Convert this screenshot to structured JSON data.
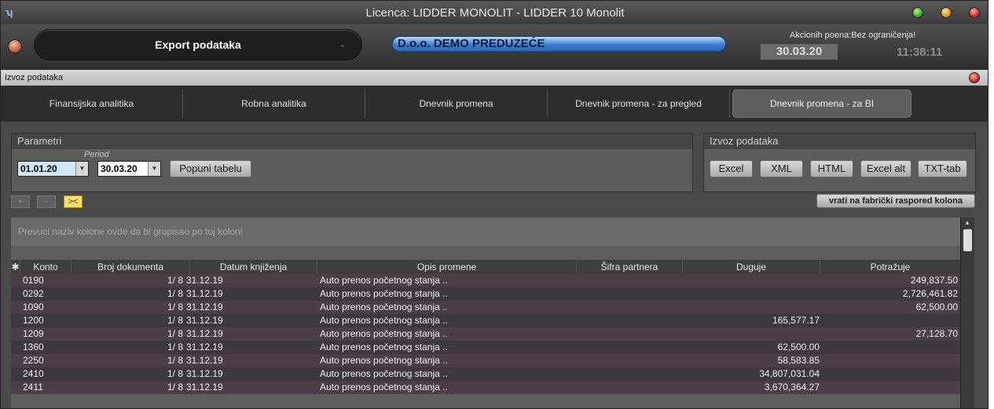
{
  "window": {
    "title": "Licenca: LIDDER MONOLIT - LIDDER 10 Monolit",
    "icon": "app-logo-icon"
  },
  "header": {
    "module": "Export podataka",
    "module_dash": "-",
    "company": "D.o.o. DEMO PREDUZEĆE",
    "promo": "Akcionih poena:Bez ograničenja!",
    "date": "30.03.20",
    "time": "11:38:11"
  },
  "subwindow": {
    "title": "Izvoz podataka"
  },
  "tabs": [
    {
      "label": "Finansijska analitika"
    },
    {
      "label": "Robna analitika"
    },
    {
      "label": "Dnevnik promena"
    },
    {
      "label": "Dnevnik promena - za pregled"
    },
    {
      "label": "Dnevnik promena - za BI",
      "active": true
    }
  ],
  "params": {
    "title": "Parametri",
    "period_label": "Period",
    "from": "01.01.20",
    "to": "30.03.20",
    "fill_button": "Popuni tabelu"
  },
  "export": {
    "title": "Izvoz podataka",
    "buttons": [
      "Excel",
      "XML",
      "HTML",
      "Excel alt",
      "TXT-tab"
    ]
  },
  "toolbar": {
    "plus": "+",
    "minus": "-",
    "collapse": "><",
    "reset_columns": "vrati na fabrički raspored kolona"
  },
  "grid": {
    "group_hint": "Prevuci naziv kolone ovde da bi grupisao po toj koloni",
    "columns": [
      "Konto",
      "Broj dokumenta",
      "Datum knjiženja",
      "Opis promene",
      "Šifra partnera",
      "Duguje",
      "Potražuje"
    ],
    "rows": [
      {
        "konto": "0190",
        "broj": "1/ 8",
        "datum": "31.12.19",
        "opis": "Auto prenos početnog stanja ..",
        "sifra": "",
        "duguje": "",
        "potrazuje": "249,837.50"
      },
      {
        "konto": "0292",
        "broj": "1/ 8",
        "datum": "31.12.19",
        "opis": "Auto prenos početnog stanja ..",
        "sifra": "",
        "duguje": "",
        "potrazuje": "2,726,461.82"
      },
      {
        "konto": "1090",
        "broj": "1/ 8",
        "datum": "31.12.19",
        "opis": "Auto prenos početnog stanja ..",
        "sifra": "",
        "duguje": "",
        "potrazuje": "62,500.00"
      },
      {
        "konto": "1200",
        "broj": "1/ 8",
        "datum": "31.12.19",
        "opis": "Auto prenos početnog stanja ..",
        "sifra": "",
        "duguje": "165,577.17",
        "potrazuje": ""
      },
      {
        "konto": "1209",
        "broj": "1/ 8",
        "datum": "31.12.19",
        "opis": "Auto prenos početnog stanja ..",
        "sifra": "",
        "duguje": "",
        "potrazuje": "27,128.70"
      },
      {
        "konto": "1360",
        "broj": "1/ 8",
        "datum": "31.12.19",
        "opis": "Auto prenos početnog stanja ..",
        "sifra": "",
        "duguje": "62,500.00",
        "potrazuje": ""
      },
      {
        "konto": "2250",
        "broj": "1/ 8",
        "datum": "31.12.19",
        "opis": "Auto prenos početnog stanja ..",
        "sifra": "",
        "duguje": "58,583.85",
        "potrazuje": ""
      },
      {
        "konto": "2410",
        "broj": "1/ 8",
        "datum": "31.12.19",
        "opis": "Auto prenos početnog stanja ..",
        "sifra": "",
        "duguje": "34,807,031.04",
        "potrazuje": ""
      },
      {
        "konto": "2411",
        "broj": "1/ 8",
        "datum": "31.12.19",
        "opis": "Auto prenos početnog stanja ..",
        "sifra": "",
        "duguje": "3,670,364.27",
        "potrazuje": ""
      }
    ]
  }
}
